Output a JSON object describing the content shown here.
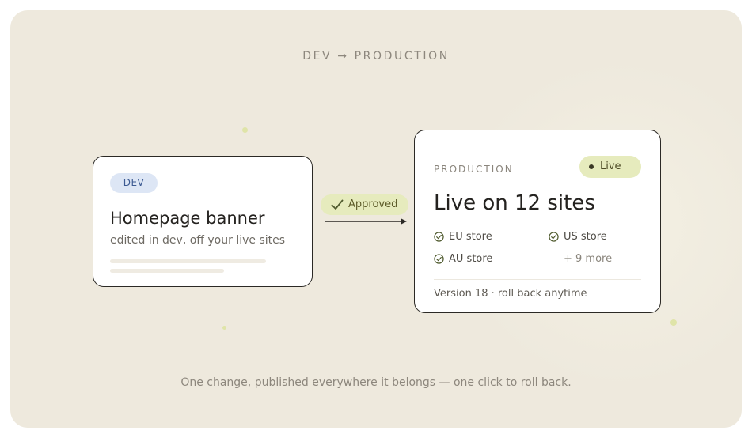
{
  "heading": "DEV → PRODUCTION",
  "dev_card": {
    "badge": "DEV",
    "title": "Homepage banner",
    "subtitle": "edited in dev, off your live sites"
  },
  "transition": {
    "label": "Approved",
    "icon": "check-icon"
  },
  "prod_card": {
    "label": "PRODUCTION",
    "status": "Live",
    "title": "Live on 12 sites",
    "sites": [
      "EU store",
      "US store",
      "AU store"
    ],
    "more": "+ 9 more",
    "version": "Version 18 · roll back anytime"
  },
  "caption": "One change, published everywhere it belongs — one click to roll back.",
  "colors": {
    "background": "#eee9dd",
    "card": "#ffffff",
    "card_border": "#2b2925",
    "dev_badge_bg": "#dde6f5",
    "dev_badge_text": "#3c5a92",
    "approved_bg": "#e6ebbd",
    "check": "#4f5a2e",
    "accent_dots": "#dfe4a8"
  }
}
